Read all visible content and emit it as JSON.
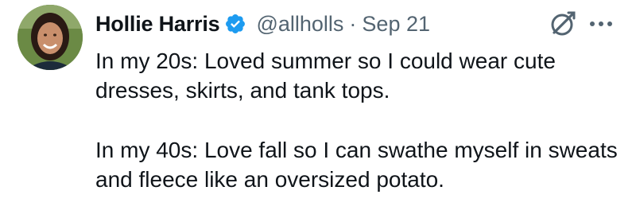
{
  "tweet": {
    "author": {
      "display_name": "Hollie Harris",
      "handle": "@allholls",
      "verified": true,
      "avatar_icon": "avatar-photo"
    },
    "separator": "·",
    "date": "Sep 21",
    "paragraphs": [
      "In my 20s: Loved summer so I could wear cute dresses, skirts, and tank tops.",
      "In my 40s: Love fall so I can swathe myself in sweats and fleece like an oversized potato."
    ],
    "icons": {
      "verified": "verified-badge-icon",
      "grok": "grok-icon",
      "more": "more-options-icon"
    },
    "colors": {
      "text": "#0f1419",
      "secondary": "#536471",
      "verified_blue": "#1d9bf0"
    }
  }
}
